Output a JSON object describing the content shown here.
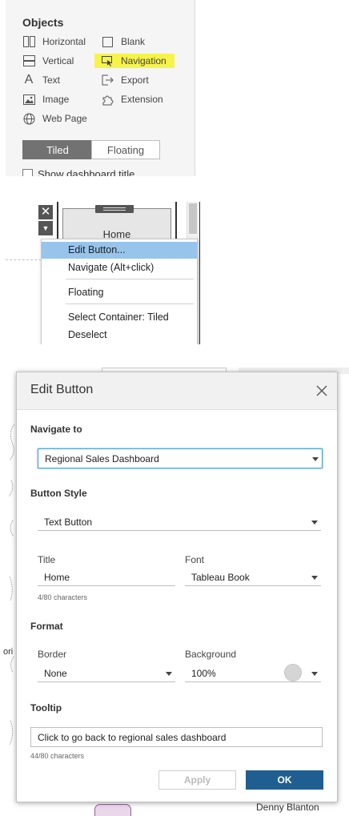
{
  "objects_panel": {
    "title": "Objects",
    "items": [
      {
        "label": "Horizontal",
        "icon": "horizontal-container-icon"
      },
      {
        "label": "Blank",
        "icon": "blank-icon"
      },
      {
        "label": "Vertical",
        "icon": "vertical-container-icon"
      },
      {
        "label": "Navigation",
        "icon": "navigation-icon",
        "highlight_color": "#f6f44a"
      },
      {
        "label": "Text",
        "icon": "text-icon"
      },
      {
        "label": "Export",
        "icon": "export-icon"
      },
      {
        "label": "Image",
        "icon": "image-icon"
      },
      {
        "label": "Extension",
        "icon": "extension-icon"
      },
      {
        "label": "Web Page",
        "icon": "globe-icon"
      }
    ],
    "layout_toggle": {
      "tiled": "Tiled",
      "floating": "Floating",
      "selected": "Tiled"
    },
    "show_title_label": "Show dashboard title"
  },
  "context_menu": {
    "button_preview_label": "Home",
    "close_symbol": "✕",
    "more_symbol": "▼",
    "items": [
      {
        "label": "Edit Button...",
        "selected": true
      },
      {
        "label": "Navigate (Alt+click)"
      },
      {
        "label": "Floating"
      },
      {
        "label": "Select Container: Tiled"
      },
      {
        "label": "Deselect"
      }
    ],
    "selected_color": "#97c4eb"
  },
  "dialog": {
    "title": "Edit Button",
    "navigate_to": {
      "label": "Navigate to",
      "value": "Regional Sales Dashboard"
    },
    "button_style": {
      "label": "Button Style",
      "value": "Text Button"
    },
    "title_field": {
      "label": "Title",
      "value": "Home",
      "count": "4/80 characters"
    },
    "font_field": {
      "label": "Font",
      "value": "Tableau Book"
    },
    "format": {
      "label": "Format",
      "border": {
        "label": "Border",
        "value": "None"
      },
      "background": {
        "label": "Background",
        "value": "100%",
        "swatch_color": "#d5d5d5"
      }
    },
    "tooltip": {
      "label": "Tooltip",
      "value": "Click to go back to regional sales dashboard",
      "count": "44/80 characters"
    },
    "apply_label": "Apply",
    "ok_label": "OK",
    "ok_color": "#1f5e91"
  },
  "background": {
    "bottom_name": "Denny Blanton",
    "edge_label": "ori"
  }
}
